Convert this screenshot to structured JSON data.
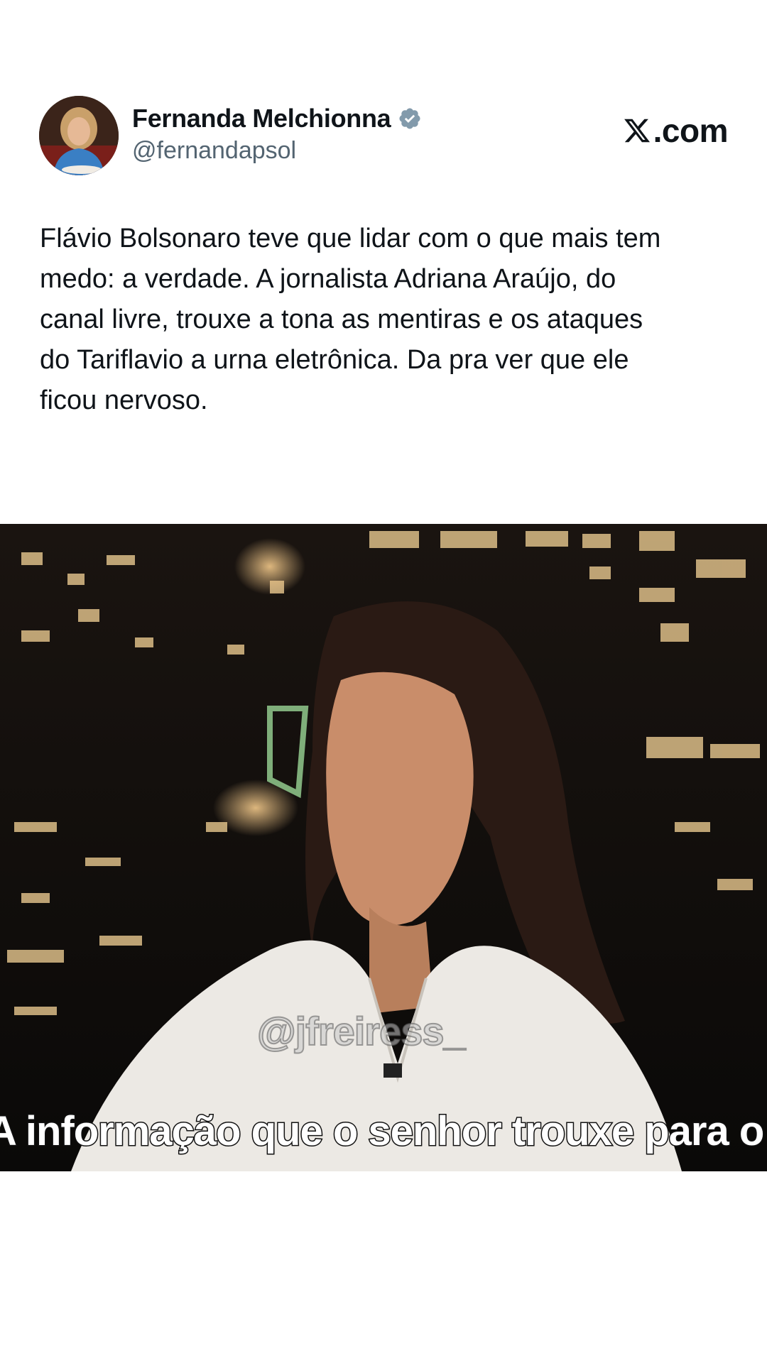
{
  "post": {
    "author": {
      "display_name": "Fernanda Melchionna",
      "handle": "@fernandapsol",
      "verified": true,
      "avatar_icon": "profile-photo-avatar"
    },
    "brand": {
      "label": ".com",
      "icon": "x-logo-icon"
    },
    "text": "Flávio Bolsonaro teve que lidar com o que mais tem\nmedo: a verdade. A jornalista Adriana Araújo, do\ncanal livre, trouxe a tona as mentiras e os ataques\ndo Tariflavio a urna eletrônica. Da pra ver que ele\nficou nervoso.",
    "media": {
      "type": "video-still",
      "watermark": "@jfreiress_",
      "subtitle": "A informação que o senhor trouxe para o"
    }
  },
  "colors": {
    "text_primary": "#0f1419",
    "text_secondary": "#536471",
    "verified_badge": "#829aab",
    "background": "#ffffff"
  }
}
